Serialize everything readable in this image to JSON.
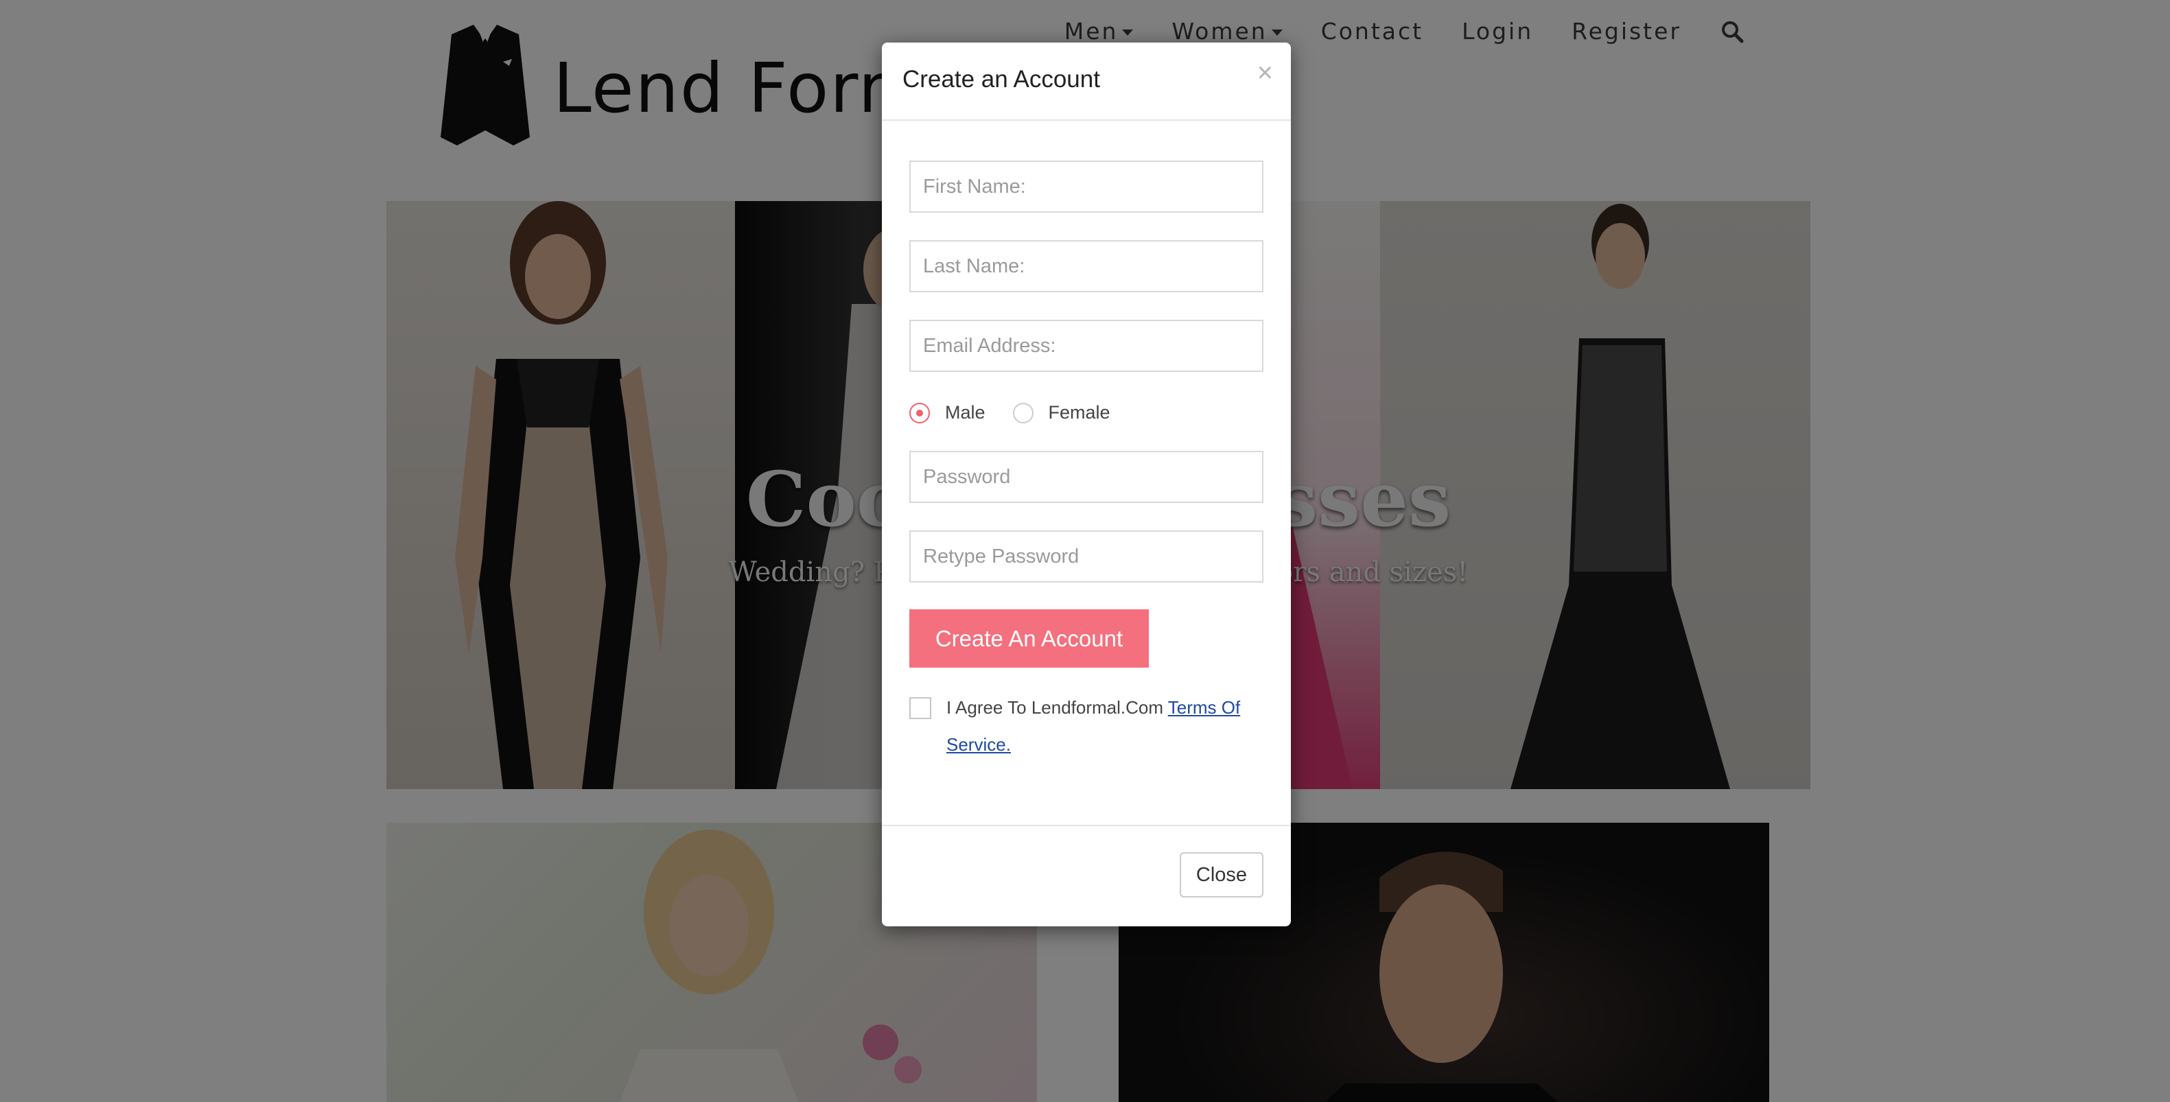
{
  "site": {
    "logo_text": "Lend Formal",
    "nav": [
      {
        "label": "Men",
        "has_caret": true
      },
      {
        "label": "Women",
        "has_caret": true
      },
      {
        "label": "Contact",
        "has_caret": false
      },
      {
        "label": "Login",
        "has_caret": false
      },
      {
        "label": "Register",
        "has_caret": false
      }
    ],
    "search_icon": "search-icon"
  },
  "hero": {
    "title": "Cocktail Dresses",
    "subtitle": "Wedding? Prom? Party? We have all colors and sizes!"
  },
  "modal": {
    "title": "Create an Account",
    "close_x": "×",
    "fields": {
      "first_name": "First Name:",
      "last_name": "Last Name:",
      "email": "Email Address:",
      "password": "Password",
      "retype_password": "Retype Password"
    },
    "gender": {
      "options": [
        "Male",
        "Female"
      ],
      "selected": "Male"
    },
    "submit_label": "Create An Account",
    "agree_text": "I Agree To Lendformal.Com ",
    "agree_link": "Terms Of Service.",
    "close_label": "Close"
  },
  "colors": {
    "accent": "#f4707e",
    "radio_active": "#f0606e",
    "link": "#1f4aa0",
    "backdrop": "rgba(0,0,0,0.5)"
  }
}
